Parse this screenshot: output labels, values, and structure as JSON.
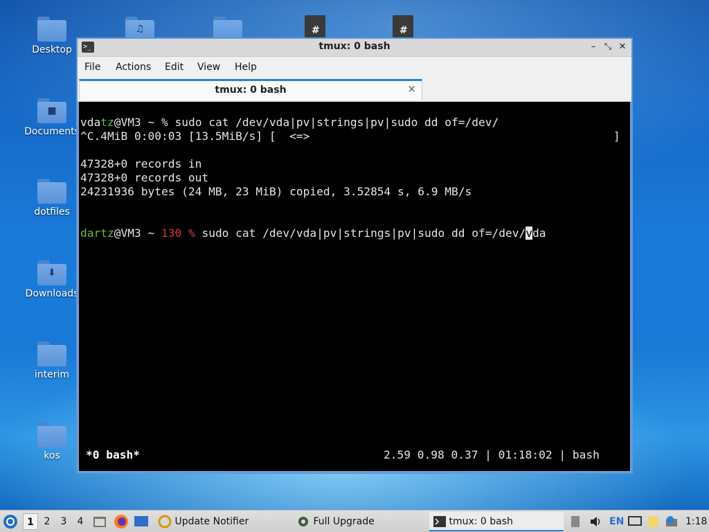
{
  "desktop": {
    "icons": [
      {
        "label": "Desktop",
        "glyph": ""
      },
      {
        "label": "Documents",
        "glyph": "■"
      },
      {
        "label": "dotfiles",
        "glyph": ""
      },
      {
        "label": "Downloads",
        "glyph": "⬇"
      },
      {
        "label": "interim",
        "glyph": ""
      },
      {
        "label": "kos",
        "glyph": ""
      }
    ],
    "top_icons": [
      {
        "name": "music-folder-icon",
        "glyph": "♫"
      },
      {
        "name": "folder-icon",
        "glyph": ""
      },
      {
        "name": "spreadsheet-file-icon",
        "glyph": "#"
      },
      {
        "name": "spreadsheet-file-icon-2",
        "glyph": "#"
      }
    ]
  },
  "window": {
    "title": "tmux: 0 bash",
    "controls": {
      "minimize": "–",
      "maximize": "⤡",
      "close": "✕"
    },
    "app_icon": ">_",
    "menu": [
      "File",
      "Actions",
      "Edit",
      "View",
      "Help"
    ],
    "tab": {
      "label": "tmux: 0 bash",
      "close": "×"
    }
  },
  "terminal": {
    "line1": {
      "user_a": "vda",
      "user_b": "tz",
      "host": "@VM3 ~ % ",
      "cmd": "sudo cat /dev/vda|pv|strings|pv|sudo dd of=/dev/"
    },
    "line2": "^C.4MiB 0:00:03 [13.5MiB/s] [  <=>                                             ]",
    "line3": "47328+0 records in",
    "line4": "47328+0 records out",
    "line5": "24231936 bytes (24 MB, 23 MiB) copied, 3.52854 s, 6.9 MB/s",
    "prompt": {
      "user": "dartz",
      "host": "@VM3 ~ ",
      "code": "130 %",
      "cmd": " sudo cat /dev/vda|pv|strings|pv|sudo dd of=/dev/",
      "cursor_char": "v",
      "after": "da"
    },
    "status": {
      "left": "*0 bash*",
      "right": "2.59 0.98 0.37 | 01:18:02 | bash"
    }
  },
  "taskbar": {
    "workspaces": [
      "1",
      "2",
      "3",
      "4"
    ],
    "active_workspace": "1",
    "tasks": [
      {
        "label": "Update Notifier"
      },
      {
        "label": "Full Upgrade"
      },
      {
        "label": "tmux: 0 bash"
      }
    ],
    "lang": "EN",
    "clock": "1:18",
    "colors": {
      "accent": "#2f7fd6"
    }
  }
}
